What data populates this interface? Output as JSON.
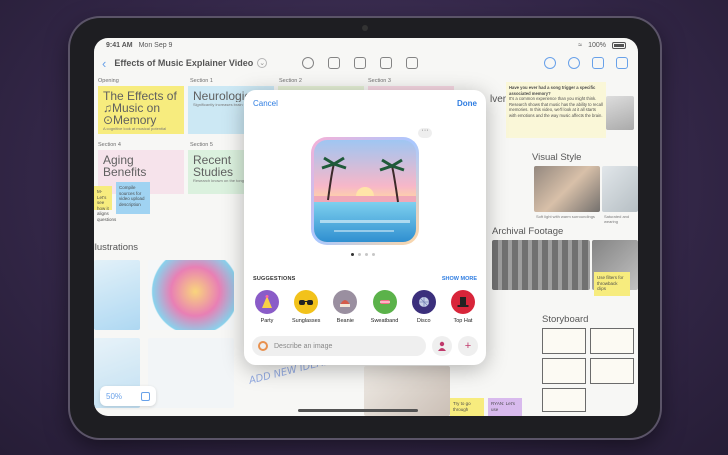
{
  "status": {
    "time": "9:41 AM",
    "date": "Mon Sep 9",
    "battery": "100%"
  },
  "toolbar": {
    "title": "Effects of Music Explainer Video"
  },
  "board": {
    "sections": [
      "Opening",
      "Section 1",
      "Section 2",
      "Section 3",
      "Section 4",
      "Section 5"
    ],
    "opening_title": "The Effects of ♫Music on ⊙Memory",
    "opening_sub": "A cognitive look at musical potential",
    "neuro_title": "Neurologic Connectivi",
    "neuro_sub": "Significantly increases brain function",
    "aging_title": "Aging Benefits",
    "recent_title": "Recent Studies",
    "recent_sub": "Research known on the tongue nerve",
    "sticky_compile": "Compile sources for video upload description",
    "sticky_small": "M- Let's see how it aligns questions",
    "illustrations": "Illustrations",
    "question": "Have you ever had a song trigger a specific associated memory?",
    "question_body": "It's a common experience than you might think. Research shows that music has the ability to recall memories. In this video, we'll look at it all starts with emotions and the way music affects the brain.",
    "partial_heading": "lvers",
    "visual_style": "Visual Style",
    "visual_caption": "Soft light with warm surroundings",
    "visual_caption2": "Saturated and wearing",
    "archival": "Archival Footage",
    "archival_note": "Use filters for throwback clips",
    "storyboard": "Storyboard",
    "bottom_note1": "Try to go through",
    "bottom_note2": "RYAN: Let's use",
    "handwritten": "ADD NEW IDEAS",
    "zoom": "50%"
  },
  "modal": {
    "cancel": "Cancel",
    "done": "Done",
    "suggestions_title": "SUGGESTIONS",
    "show_more": "SHOW MORE",
    "suggestions": [
      {
        "label": "Party",
        "icon": "party-hat-icon",
        "color": "#8a5cc8"
      },
      {
        "label": "Sunglasses",
        "icon": "sunglasses-icon",
        "color": "#f2c21b"
      },
      {
        "label": "Beanie",
        "icon": "beanie-icon",
        "color": "#9a8fa0"
      },
      {
        "label": "Sweatband",
        "icon": "sweatband-icon",
        "color": "#5bb24a"
      },
      {
        "label": "Disco",
        "icon": "disco-ball-icon",
        "color": "#3b2f7c"
      },
      {
        "label": "Top Hat",
        "icon": "top-hat-icon",
        "color": "#d8253a"
      }
    ],
    "input_placeholder": "Describe an image"
  },
  "colors": {
    "accent": "#2f7de1"
  }
}
